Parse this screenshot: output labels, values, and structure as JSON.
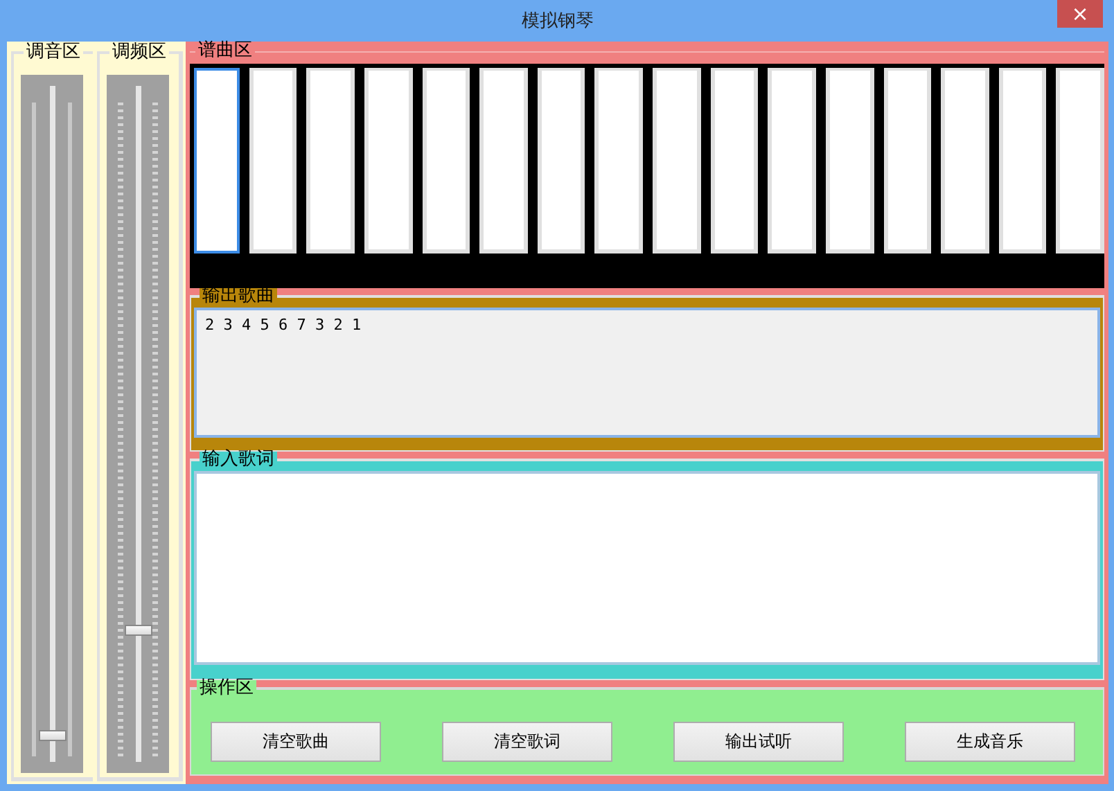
{
  "window": {
    "title": "模拟钢琴",
    "close": "×"
  },
  "tuning": [
    {
      "title": "调音区",
      "kind": "plain",
      "level": 0.02
    },
    {
      "title": "调频区",
      "kind": "ticked",
      "level": 0.18
    }
  ],
  "composer": {
    "title": "谱曲区",
    "keys": [
      {
        "selected": true
      },
      {
        "selected": false
      },
      {
        "selected": false
      },
      {
        "selected": false
      },
      {
        "selected": false
      },
      {
        "selected": false
      },
      {
        "selected": false
      },
      {
        "selected": false
      },
      {
        "selected": false
      },
      {
        "selected": false
      },
      {
        "selected": false
      },
      {
        "selected": false
      },
      {
        "selected": false
      },
      {
        "selected": false
      },
      {
        "selected": false
      },
      {
        "selected": false
      }
    ]
  },
  "output_song": {
    "title": "输出歌曲",
    "value": "2 3 4 5 6 7 3 2 1"
  },
  "input_lyrics": {
    "title": "输入歌词"
  },
  "operations": {
    "title": "操作区",
    "buttons": [
      "清空歌曲",
      "清空歌词",
      "输出试听",
      "生成音乐"
    ]
  }
}
